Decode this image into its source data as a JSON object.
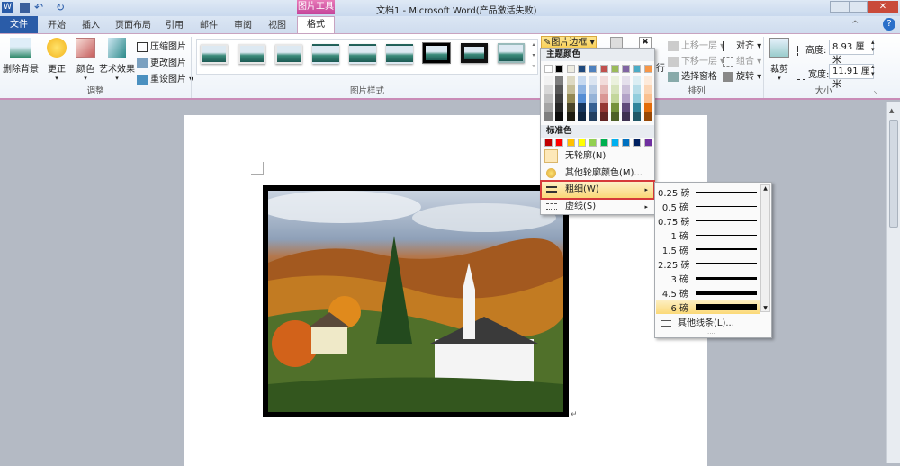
{
  "title": "文档1 - Microsoft Word(产品激活失败)",
  "context_tab": "图片工具",
  "tabs": [
    "文件",
    "开始",
    "插入",
    "页面布局",
    "引用",
    "邮件",
    "审阅",
    "视图",
    "格式"
  ],
  "ribbon": {
    "remove_bg": "删除背景",
    "corrections": "更正",
    "color": "颜色",
    "artistic": "艺术效果",
    "compress": "压缩图片",
    "change": "更改图片",
    "reset": "重设图片",
    "group_adjust": "调整",
    "group_styles": "图片样式",
    "picture_border": "图片边框",
    "wrap_suffix": "行",
    "bring_forward": "上移一层",
    "send_backward": "下移一层",
    "selection_pane": "选择窗格",
    "align": "对齐",
    "group": "组合",
    "rotate": "旋转",
    "group_arrange": "排列",
    "crop": "裁剪",
    "height_label": "高度:",
    "height_value": "8.93 厘米",
    "width_label": "宽度:",
    "width_value": "11.91 厘米",
    "group_size": "大小"
  },
  "border_menu": {
    "theme_colors_label": "主题颜色",
    "theme_colors": [
      "#ffffff",
      "#000000",
      "#eeece1",
      "#1f497d",
      "#4f81bd",
      "#c0504d",
      "#9bbb59",
      "#8064a2",
      "#4bacc6",
      "#f79646"
    ],
    "theme_shades": [
      [
        "#f2f2f2",
        "#7f7f7f",
        "#ddd9c3",
        "#c6d9f0",
        "#dbe5f1",
        "#f2dcdb",
        "#ebf1dd",
        "#e5e0ec",
        "#dbeef3",
        "#fdeada"
      ],
      [
        "#d8d8d8",
        "#595959",
        "#c4bd97",
        "#8db3e2",
        "#b8cce4",
        "#e5b9b7",
        "#d7e3bc",
        "#ccc1d9",
        "#b7dde8",
        "#fbd5b5"
      ],
      [
        "#bfbfbf",
        "#3f3f3f",
        "#938953",
        "#548dd4",
        "#95b3d7",
        "#d99694",
        "#c3d69b",
        "#b2a2c7",
        "#92cddc",
        "#fac08f"
      ],
      [
        "#a5a5a5",
        "#262626",
        "#494429",
        "#17365d",
        "#366092",
        "#953734",
        "#76923c",
        "#5f497a",
        "#31859b",
        "#e36c09"
      ],
      [
        "#7f7f7f",
        "#0c0c0c",
        "#1d1b10",
        "#0f243e",
        "#244061",
        "#632423",
        "#4f6128",
        "#3f3151",
        "#205867",
        "#974806"
      ]
    ],
    "standard_label": "标准色",
    "standard_colors": [
      "#c00000",
      "#ff0000",
      "#ffc000",
      "#ffff00",
      "#92d050",
      "#00b050",
      "#00b0f0",
      "#0070c0",
      "#002060",
      "#7030a0"
    ],
    "no_outline": "无轮廓(N)",
    "more_colors": "其他轮廓颜色(M)...",
    "weight": "粗细(W)",
    "dashes": "虚线(S)"
  },
  "weight_menu": {
    "items": [
      {
        "label": "0.25 磅",
        "pt": 0.25
      },
      {
        "label": "0.5 磅",
        "pt": 0.5
      },
      {
        "label": "0.75 磅",
        "pt": 0.75
      },
      {
        "label": "1 磅",
        "pt": 1
      },
      {
        "label": "1.5 磅",
        "pt": 1.5
      },
      {
        "label": "2.25 磅",
        "pt": 2.25
      },
      {
        "label": "3 磅",
        "pt": 3
      },
      {
        "label": "4.5 磅",
        "pt": 4.5
      },
      {
        "label": "6 磅",
        "pt": 6
      }
    ],
    "selected": "6 磅",
    "more_lines": "其他线条(L)..."
  }
}
